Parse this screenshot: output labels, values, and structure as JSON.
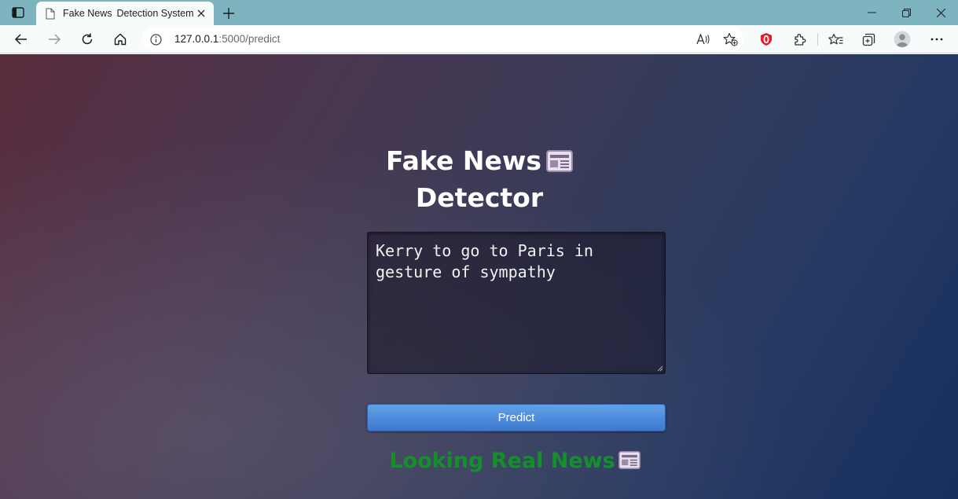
{
  "browser": {
    "tab": {
      "title_part1": "Fake News",
      "title_part2": "Detection System"
    },
    "address": {
      "host": "127.0.0.1",
      "rest": ":5000/predict"
    }
  },
  "page": {
    "heading_line1": "Fake News",
    "heading_line2": "Detector",
    "news_input_value": "Kerry to go to Paris in gesture of sympathy",
    "predict_label": "Predict",
    "result_text": "Looking Real News"
  },
  "colors": {
    "titlebar": "#7db4bf",
    "result_green": "#14902a",
    "button_blue": "#4a8ad9"
  },
  "icons": [
    "sidebar-toggle-icon",
    "page-favicon-icon",
    "newspaper-icon",
    "close-icon",
    "plus-icon",
    "minimize-icon",
    "restore-icon",
    "back-arrow-icon",
    "forward-arrow-icon",
    "refresh-icon",
    "home-icon",
    "info-icon",
    "read-aloud-icon",
    "add-favorite-icon",
    "opera-extension-icon",
    "puzzle-icon",
    "favorites-icon",
    "collections-icon",
    "profile-avatar-icon",
    "more-options-icon"
  ]
}
